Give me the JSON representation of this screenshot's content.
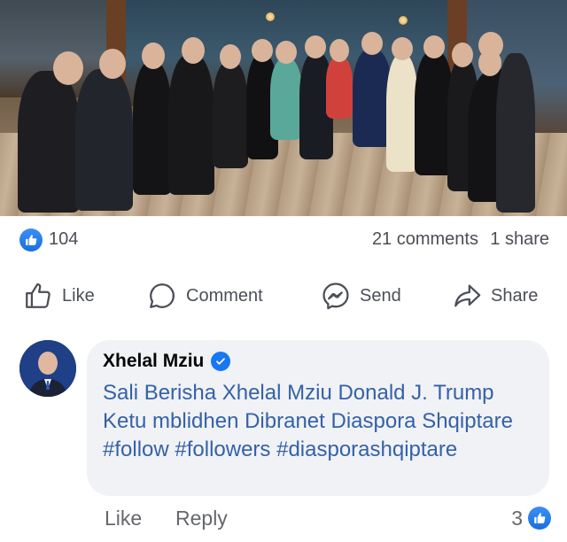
{
  "post": {
    "photo_icon": "group-photo"
  },
  "reactions": {
    "like_icon": "like-reaction-icon",
    "like_count": "104",
    "comments": "21 comments",
    "shares": "1 share"
  },
  "actions": [
    {
      "label": "Like",
      "icon": "thumbs-up-icon"
    },
    {
      "label": "Comment",
      "icon": "speech-bubble-icon"
    },
    {
      "label": "Send",
      "icon": "messenger-icon"
    },
    {
      "label": "Share",
      "icon": "share-arrow-icon"
    }
  ],
  "comment": {
    "author": "Xhelal Mziu",
    "verified": true,
    "text": "Sali Berisha Xhelal Mziu Donald J. Trump Ketu mblidhen Dibranet Diaspora Shqiptare #follow #followers #diasporashqiptare",
    "like_label": "Like",
    "reply_label": "Reply",
    "reaction_count": "3"
  },
  "colors": {
    "accent": "#1877f2",
    "text_muted": "#65676b",
    "link_text": "#3561a8",
    "bubble_bg": "#f0f2f5"
  }
}
